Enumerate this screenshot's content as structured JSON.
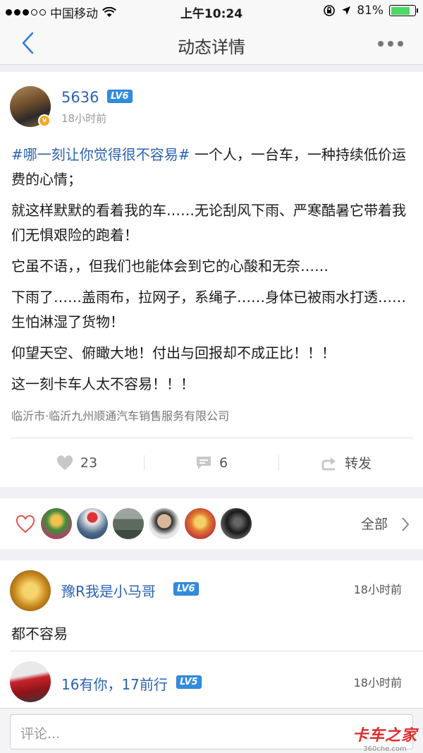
{
  "status_bar": {
    "carrier": "中国移动",
    "time": "上午10:24",
    "battery": "81%",
    "battery_level": 0.81
  },
  "nav": {
    "title": "动态详情"
  },
  "post": {
    "username": "5636",
    "level": "LV6",
    "time": "18小时前",
    "hashtag": "#哪一刻让你觉得很不容易#",
    "first_line_rest": " 一个人，一台车，一种持续低价运费的心情；",
    "paragraphs": [
      "就这样默默的看着我的车……无论刮风下雨、严寒酷暑它带着我们无惧艰险的跑着！",
      "它虽不语，，但我们也能体会到它的心酸和无奈……",
      "下雨了……盖雨布，拉网子，系绳子……身体已被雨水打透……生怕淋湿了货物！",
      "仰望天空、俯瞰大地！付出与回报却不成正比！！！",
      "这一刻卡车人太不容易！！！"
    ],
    "location": "临沂市·临沂九州顺通汽车销售服务有限公司",
    "likes": "23",
    "comments": "6",
    "forward_label": "转发"
  },
  "likers": {
    "all_label": "全部"
  },
  "comments": [
    {
      "name": "豫R我是小马哥",
      "level": "LV6",
      "time": "18小时前",
      "text": "都不容易"
    },
    {
      "name": "16有你，17前行",
      "level": "LV5",
      "time": "18小时前"
    }
  ],
  "input": {
    "placeholder": "评论..."
  },
  "watermark": {
    "brand": "卡车之家",
    "domain": "360che.com"
  }
}
